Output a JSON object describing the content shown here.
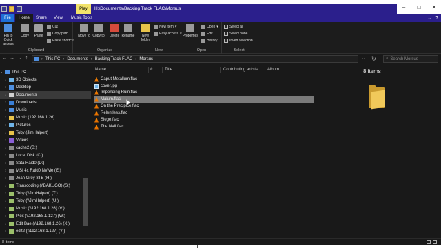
{
  "titlebar": {
    "play_tab": "Play",
    "title": "H:\\Documents\\Backing Track FLAC\\Morsus",
    "controls": [
      "–",
      "□",
      "✕"
    ]
  },
  "tabs": {
    "file": "File",
    "home": "Home",
    "share": "Share",
    "view": "View",
    "music_tools": "Music Tools"
  },
  "ribbon": {
    "clipboard": {
      "label": "Clipboard",
      "pin": "Pin to Quick access",
      "copy": "Copy",
      "paste": "Paste",
      "cut": "Cut",
      "copy_path": "Copy path",
      "paste_shortcut": "Paste shortcut"
    },
    "organize": {
      "label": "Organize",
      "move_to": "Move to",
      "copy_to": "Copy to",
      "delete": "Delete",
      "rename": "Rename"
    },
    "new": {
      "label": "New",
      "new_folder": "New folder",
      "new_item": "New item",
      "easy_access": "Easy access"
    },
    "open": {
      "label": "Open",
      "properties": "Properties",
      "open": "Open",
      "edit": "Edit",
      "history": "History"
    },
    "select": {
      "label": "Select",
      "select_all": "Select all",
      "select_none": "Select none",
      "invert_selection": "Invert selection"
    }
  },
  "address": {
    "crumbs": [
      "This PC",
      "Documents",
      "Backing Track FLAC",
      "Morsus"
    ],
    "search_placeholder": "Search Morsus"
  },
  "sidebar": {
    "items": [
      {
        "label": "This PC",
        "icon": "pc-icon"
      },
      {
        "label": "3D Objects",
        "icon": "cube-icon"
      },
      {
        "label": "Desktop",
        "icon": "desktop-icon"
      },
      {
        "label": "Documents",
        "icon": "documents-icon"
      },
      {
        "label": "Downloads",
        "icon": "downloads-icon"
      },
      {
        "label": "Music",
        "icon": "music-icon"
      },
      {
        "label": "Music (192.168.1.26)",
        "icon": "folder-icon"
      },
      {
        "label": "Pictures",
        "icon": "pictures-icon"
      },
      {
        "label": "Toby (JimHalpert)",
        "icon": "folder-icon"
      },
      {
        "label": "Videos",
        "icon": "videos-icon"
      },
      {
        "label": "cache2 (B:)",
        "icon": "drive-icon"
      },
      {
        "label": "Local Disk (C:)",
        "icon": "drive-icon"
      },
      {
        "label": "Sata Raid0 (D:)",
        "icon": "drive-icon"
      },
      {
        "label": "MSI 4x Raid0 NVMe (E:)",
        "icon": "drive-icon"
      },
      {
        "label": "Jean Grey 8TB (H:)",
        "icon": "drive-icon"
      },
      {
        "label": "Transcoding (\\\\BAKUGO) (S:)",
        "icon": "network-drive-icon"
      },
      {
        "label": "Toby (\\\\JimHalpert) (T:)",
        "icon": "network-drive-icon"
      },
      {
        "label": "Toby (\\\\JimHalpert) (U:)",
        "icon": "network-drive-icon"
      },
      {
        "label": "Music (\\\\192.168.1.26) (V:)",
        "icon": "network-drive-icon"
      },
      {
        "label": "Plex (\\\\192.168.1.127) (W:)",
        "icon": "network-drive-icon"
      },
      {
        "label": "Edit Bae (\\\\192.168.1.26) (X:)",
        "icon": "network-drive-icon"
      },
      {
        "label": "edit2 (\\\\192.168.1.127) (Y:)",
        "icon": "network-drive-icon"
      }
    ],
    "selected_index": 3
  },
  "columns": {
    "name": "Name",
    "number": "#",
    "title": "Title",
    "contributing_artists": "Contributing artists",
    "album": "Album"
  },
  "files": [
    {
      "name": "Caput Metallum.flac",
      "icon": "vlc-icon"
    },
    {
      "name": "cover.jpg",
      "icon": "image-icon"
    },
    {
      "name": "Impending Ruin.flac",
      "icon": "vlc-icon"
    },
    {
      "name": "Malum.flac",
      "icon": "vlc-icon"
    },
    {
      "name": "On the Precipice.flac",
      "icon": "vlc-icon"
    },
    {
      "name": "Relentless.flac",
      "icon": "vlc-icon"
    },
    {
      "name": "Siege.flac",
      "icon": "vlc-icon"
    },
    {
      "name": "The Nail.flac",
      "icon": "vlc-icon"
    }
  ],
  "selected_file_index": 3,
  "preview": {
    "count": "8 items"
  },
  "status": {
    "count": "8 items"
  }
}
